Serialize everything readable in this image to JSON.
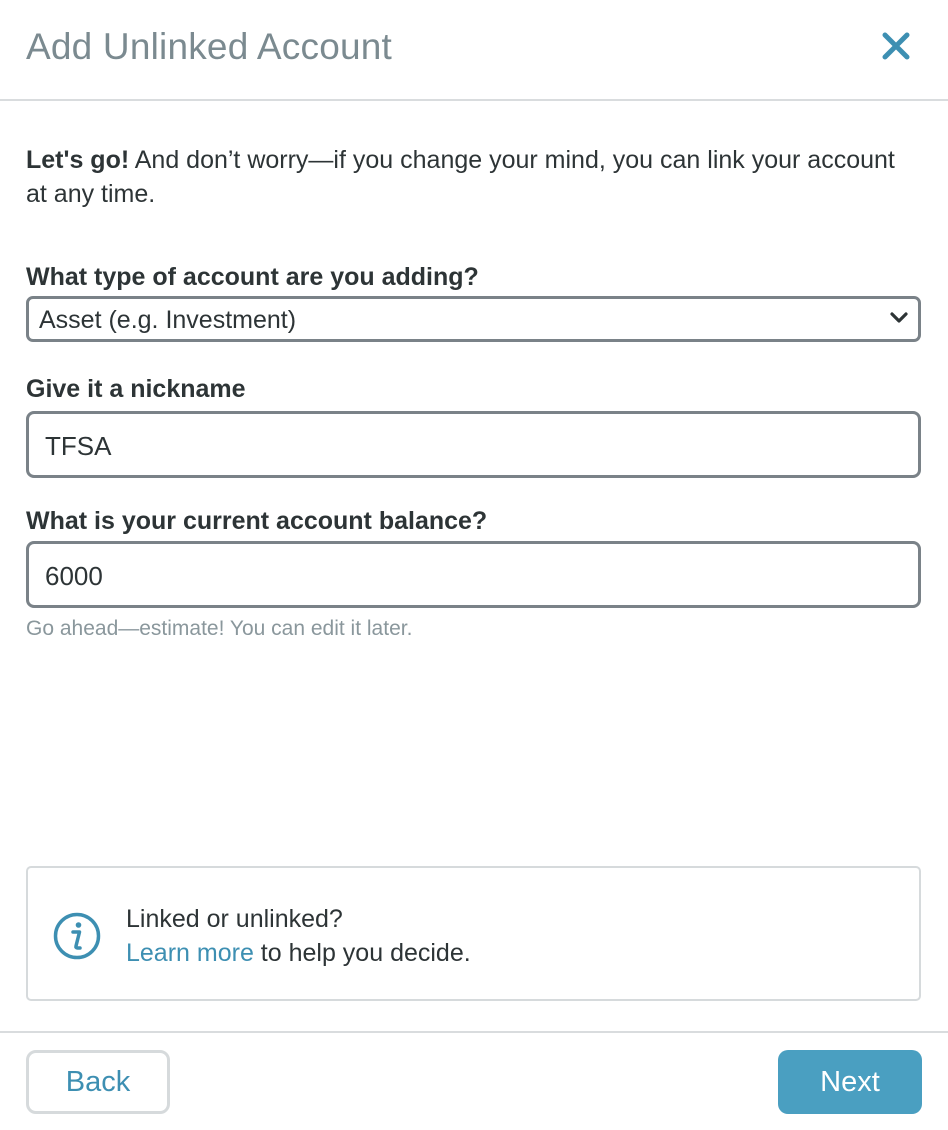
{
  "dialog": {
    "title": "Add Unlinked Account",
    "close_icon": "close-icon"
  },
  "intro": {
    "bold": "Let's go!",
    "text": " And don’t worry—if you change your mind, you can link your account at any time."
  },
  "account_type": {
    "label": "What type of account are you adding?",
    "selected": "Asset (e.g. Investment)",
    "icon": "chevron-down-icon"
  },
  "nickname": {
    "label": "Give it a nickname",
    "value": "TFSA"
  },
  "balance": {
    "label": "What is your current account balance?",
    "value": "6000",
    "hint": "Go ahead—estimate! You can edit it later."
  },
  "info": {
    "icon": "info-icon",
    "line1": "Linked or unlinked?",
    "link": "Learn more",
    "line2_rest": " to help you decide."
  },
  "footer": {
    "back_label": "Back",
    "next_label": "Next"
  },
  "colors": {
    "accent": "#4a9fc1",
    "link": "#3d8fb2",
    "title": "#7b8a90",
    "border": "#7a8288"
  }
}
